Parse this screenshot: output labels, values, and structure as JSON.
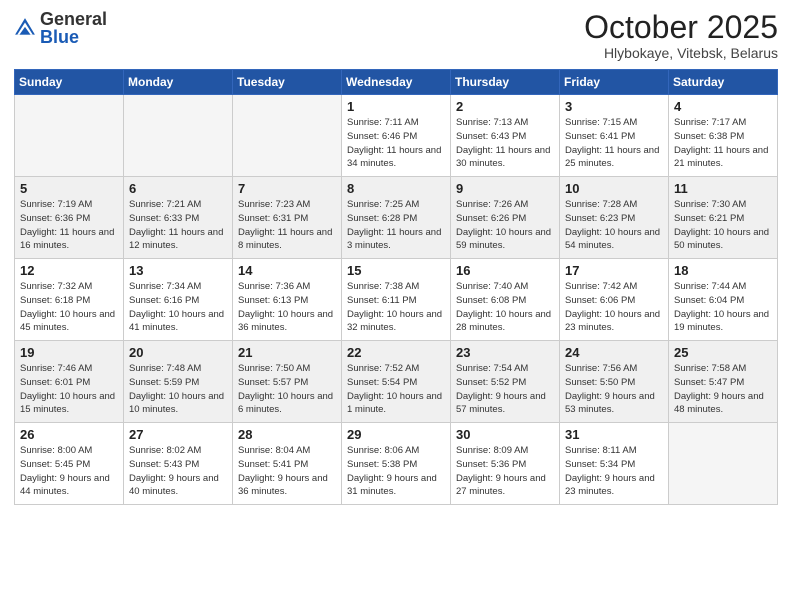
{
  "header": {
    "logo_general": "General",
    "logo_blue": "Blue",
    "month": "October 2025",
    "location": "Hlybokaye, Vitebsk, Belarus"
  },
  "days_of_week": [
    "Sunday",
    "Monday",
    "Tuesday",
    "Wednesday",
    "Thursday",
    "Friday",
    "Saturday"
  ],
  "weeks": [
    [
      {
        "day": "",
        "info": ""
      },
      {
        "day": "",
        "info": ""
      },
      {
        "day": "",
        "info": ""
      },
      {
        "day": "1",
        "info": "Sunrise: 7:11 AM\nSunset: 6:46 PM\nDaylight: 11 hours\nand 34 minutes."
      },
      {
        "day": "2",
        "info": "Sunrise: 7:13 AM\nSunset: 6:43 PM\nDaylight: 11 hours\nand 30 minutes."
      },
      {
        "day": "3",
        "info": "Sunrise: 7:15 AM\nSunset: 6:41 PM\nDaylight: 11 hours\nand 25 minutes."
      },
      {
        "day": "4",
        "info": "Sunrise: 7:17 AM\nSunset: 6:38 PM\nDaylight: 11 hours\nand 21 minutes."
      }
    ],
    [
      {
        "day": "5",
        "info": "Sunrise: 7:19 AM\nSunset: 6:36 PM\nDaylight: 11 hours\nand 16 minutes."
      },
      {
        "day": "6",
        "info": "Sunrise: 7:21 AM\nSunset: 6:33 PM\nDaylight: 11 hours\nand 12 minutes."
      },
      {
        "day": "7",
        "info": "Sunrise: 7:23 AM\nSunset: 6:31 PM\nDaylight: 11 hours\nand 8 minutes."
      },
      {
        "day": "8",
        "info": "Sunrise: 7:25 AM\nSunset: 6:28 PM\nDaylight: 11 hours\nand 3 minutes."
      },
      {
        "day": "9",
        "info": "Sunrise: 7:26 AM\nSunset: 6:26 PM\nDaylight: 10 hours\nand 59 minutes."
      },
      {
        "day": "10",
        "info": "Sunrise: 7:28 AM\nSunset: 6:23 PM\nDaylight: 10 hours\nand 54 minutes."
      },
      {
        "day": "11",
        "info": "Sunrise: 7:30 AM\nSunset: 6:21 PM\nDaylight: 10 hours\nand 50 minutes."
      }
    ],
    [
      {
        "day": "12",
        "info": "Sunrise: 7:32 AM\nSunset: 6:18 PM\nDaylight: 10 hours\nand 45 minutes."
      },
      {
        "day": "13",
        "info": "Sunrise: 7:34 AM\nSunset: 6:16 PM\nDaylight: 10 hours\nand 41 minutes."
      },
      {
        "day": "14",
        "info": "Sunrise: 7:36 AM\nSunset: 6:13 PM\nDaylight: 10 hours\nand 36 minutes."
      },
      {
        "day": "15",
        "info": "Sunrise: 7:38 AM\nSunset: 6:11 PM\nDaylight: 10 hours\nand 32 minutes."
      },
      {
        "day": "16",
        "info": "Sunrise: 7:40 AM\nSunset: 6:08 PM\nDaylight: 10 hours\nand 28 minutes."
      },
      {
        "day": "17",
        "info": "Sunrise: 7:42 AM\nSunset: 6:06 PM\nDaylight: 10 hours\nand 23 minutes."
      },
      {
        "day": "18",
        "info": "Sunrise: 7:44 AM\nSunset: 6:04 PM\nDaylight: 10 hours\nand 19 minutes."
      }
    ],
    [
      {
        "day": "19",
        "info": "Sunrise: 7:46 AM\nSunset: 6:01 PM\nDaylight: 10 hours\nand 15 minutes."
      },
      {
        "day": "20",
        "info": "Sunrise: 7:48 AM\nSunset: 5:59 PM\nDaylight: 10 hours\nand 10 minutes."
      },
      {
        "day": "21",
        "info": "Sunrise: 7:50 AM\nSunset: 5:57 PM\nDaylight: 10 hours\nand 6 minutes."
      },
      {
        "day": "22",
        "info": "Sunrise: 7:52 AM\nSunset: 5:54 PM\nDaylight: 10 hours\nand 1 minute."
      },
      {
        "day": "23",
        "info": "Sunrise: 7:54 AM\nSunset: 5:52 PM\nDaylight: 9 hours\nand 57 minutes."
      },
      {
        "day": "24",
        "info": "Sunrise: 7:56 AM\nSunset: 5:50 PM\nDaylight: 9 hours\nand 53 minutes."
      },
      {
        "day": "25",
        "info": "Sunrise: 7:58 AM\nSunset: 5:47 PM\nDaylight: 9 hours\nand 48 minutes."
      }
    ],
    [
      {
        "day": "26",
        "info": "Sunrise: 8:00 AM\nSunset: 5:45 PM\nDaylight: 9 hours\nand 44 minutes."
      },
      {
        "day": "27",
        "info": "Sunrise: 8:02 AM\nSunset: 5:43 PM\nDaylight: 9 hours\nand 40 minutes."
      },
      {
        "day": "28",
        "info": "Sunrise: 8:04 AM\nSunset: 5:41 PM\nDaylight: 9 hours\nand 36 minutes."
      },
      {
        "day": "29",
        "info": "Sunrise: 8:06 AM\nSunset: 5:38 PM\nDaylight: 9 hours\nand 31 minutes."
      },
      {
        "day": "30",
        "info": "Sunrise: 8:09 AM\nSunset: 5:36 PM\nDaylight: 9 hours\nand 27 minutes."
      },
      {
        "day": "31",
        "info": "Sunrise: 8:11 AM\nSunset: 5:34 PM\nDaylight: 9 hours\nand 23 minutes."
      },
      {
        "day": "",
        "info": ""
      }
    ]
  ]
}
